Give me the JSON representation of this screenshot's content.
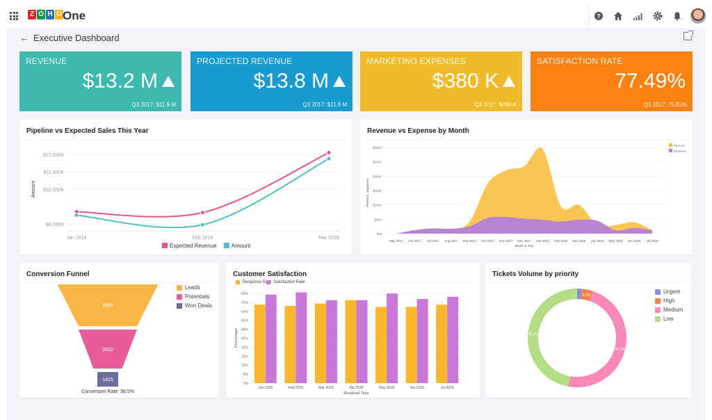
{
  "app": {
    "name": "One",
    "logo_letters": [
      "Z",
      "O",
      "H",
      "O"
    ],
    "logo_colors": [
      "#e42527",
      "#089949",
      "#226db4",
      "#f9b21d"
    ],
    "toolbar_icons": [
      "help-icon",
      "home-icon",
      "signal-icon",
      "gear-icon",
      "bell-icon"
    ]
  },
  "page": {
    "title": "Executive Dashboard"
  },
  "kpis": [
    {
      "label": "REVENUE",
      "value": "$13.2 M",
      "trend": "up",
      "sub": "Q3 2017: $11.9 M",
      "color": "#3fb8af"
    },
    {
      "label": "PROJECTED REVENUE",
      "value": "$13.8 M",
      "trend": "up",
      "sub": "Q3 2017: $11.8 M",
      "color": "#1a9bd0"
    },
    {
      "label": "MARKETING EXPENSES",
      "value": "$380 K",
      "trend": "up",
      "sub": "Q3 2017: $280 K",
      "color": "#f0bb2b"
    },
    {
      "label": "SATISFACTION RATE",
      "value": "77.49%",
      "trend": "none",
      "sub": "Q3 2017: 75.81%",
      "color": "#fb8211"
    }
  ],
  "chart_data": [
    {
      "id": "pipeline",
      "type": "line",
      "title": "Pipeline vs Expected Sales This Year",
      "xlabel": "",
      "ylabel": "Amount",
      "categories": [
        "Jan 2018",
        "Feb 2018",
        "Mar 2018"
      ],
      "yticks": [
        "$8,000K",
        "$10,000K",
        "$11,000K",
        "$12,000K"
      ],
      "ytick_values": [
        8000,
        10000,
        11000,
        12000
      ],
      "ylim": [
        7600,
        12400
      ],
      "series": [
        {
          "name": "Expected Revenue",
          "color": "#e8528b",
          "values": [
            8700,
            8650,
            12100
          ]
        },
        {
          "name": "Amount",
          "color": "#4dbfc3",
          "values": [
            8500,
            7950,
            11750
          ]
        }
      ],
      "legend": "bottom"
    },
    {
      "id": "rev-exp",
      "type": "area",
      "title": "Revenue vs Expense by Month",
      "xlabel": "Month & Year",
      "ylabel": "Revenue , Expenses",
      "categories": [
        "May 2017",
        "Jun 2017",
        "Jul 2017",
        "Aug 2017",
        "Sep 2017",
        "Oct 2017",
        "Nov 2017",
        "Dec 2017",
        "Jan 2018",
        "Feb 2018",
        "Mar 2018",
        "Apr 2018",
        "May 2018",
        "Jun 2018",
        "Jul 2018"
      ],
      "yticks": [
        "$0k",
        "$50K",
        "$100K",
        "$150K",
        "$200K",
        "$250K",
        "$300K"
      ],
      "ylim": [
        0,
        300
      ],
      "series": [
        {
          "name": "Revenue",
          "color": "#f9c34a",
          "values": [
            0,
            12,
            18,
            17,
            40,
            175,
            220,
            235,
            295,
            95,
            100,
            30,
            30,
            40,
            12
          ]
        },
        {
          "name": "Expenses",
          "color": "#b47fd6",
          "values": [
            0,
            12,
            18,
            17,
            25,
            55,
            58,
            52,
            48,
            42,
            48,
            45,
            12,
            20,
            12
          ]
        }
      ],
      "legend": "top-right"
    },
    {
      "id": "funnel",
      "type": "bar",
      "title": "Conversion Funnel",
      "categories": [
        "Leads",
        "Potentials",
        "Won Deals"
      ],
      "values": [
        3900,
        2632,
        1425
      ],
      "value_labels": [
        "3900",
        "2632",
        "1425"
      ],
      "colors": [
        "#f9b645",
        "#e75c9a",
        "#6d6d9c"
      ],
      "footer": "Conversion Rate: 36.5%",
      "legend": "right"
    },
    {
      "id": "satisfaction",
      "type": "bar",
      "title": "Customer Satisfaction",
      "xlabel": "Resolved Time",
      "ylabel": "Percentage",
      "categories": [
        "Jan 2018",
        "Feb 2018",
        "Mar 2018",
        "Apr 2018",
        "May 2018",
        "Jun 2018",
        "Jul 2018"
      ],
      "yticks": [
        "0%",
        "8%",
        "16%",
        "24%",
        "32%",
        "40%",
        "48%",
        "56%",
        "64%",
        "72%",
        "80%"
      ],
      "ylim": [
        0,
        80
      ],
      "series": [
        {
          "name": "Response Rate",
          "color": "#fbb72b",
          "values": [
            70,
            69,
            71,
            74,
            68,
            68,
            70
          ]
        },
        {
          "name": "Satisfaction Rate",
          "color": "#c879d8",
          "values": [
            79,
            81,
            74,
            74,
            80,
            75,
            77
          ]
        }
      ],
      "legend": "top-left"
    },
    {
      "id": "tickets",
      "type": "pie",
      "title": "Tickets Volume by priority",
      "categories": [
        "Urgent",
        "High",
        "Medium",
        "Low"
      ],
      "values": [
        1.5,
        3.7,
        47.7,
        47.1
      ],
      "value_labels": [
        "",
        "3.7%",
        "47.7%",
        "46.7%"
      ],
      "colors": [
        "#8b8fd9",
        "#f5824e",
        "#f98ab8",
        "#b4dd86"
      ],
      "legend": "right"
    }
  ]
}
